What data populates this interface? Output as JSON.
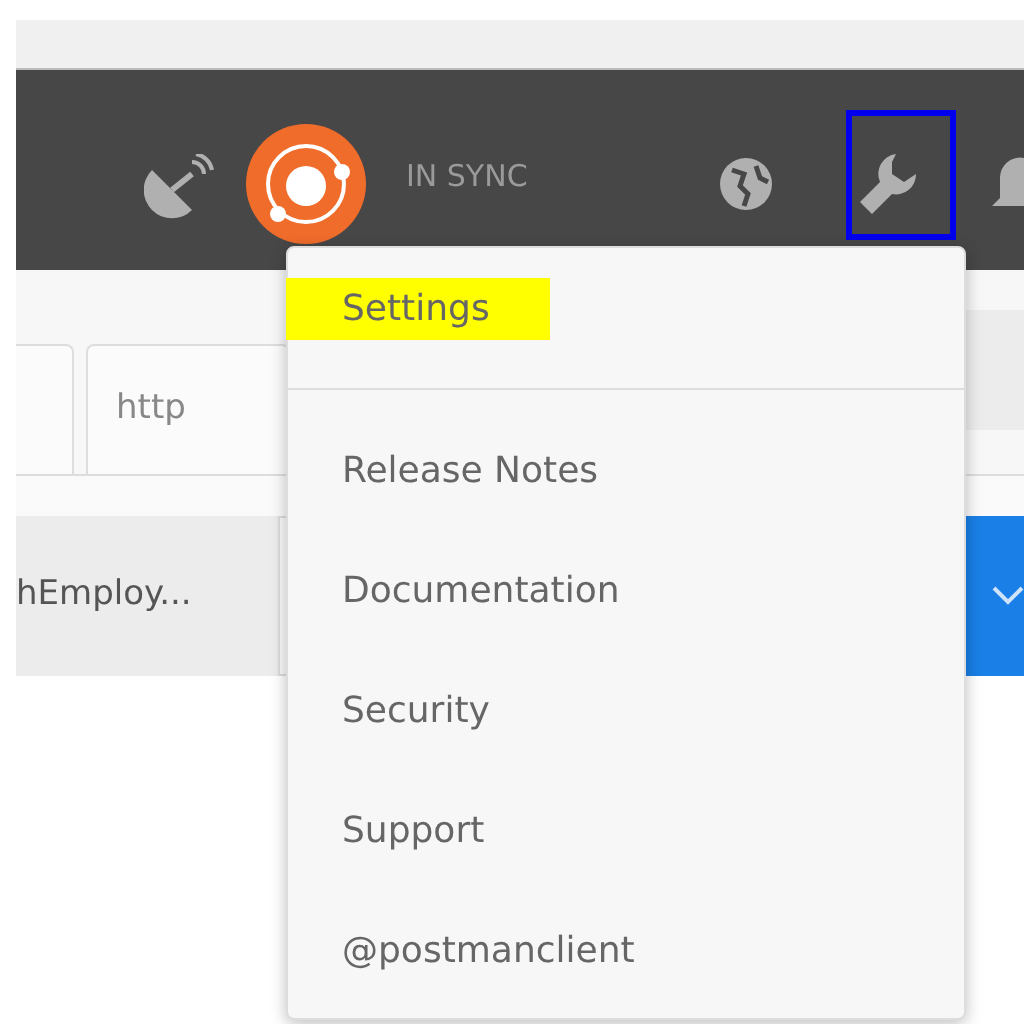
{
  "header": {
    "sync_status": "IN SYNC",
    "settings_annotated": true
  },
  "tabs": [
    {
      "kind": "partial"
    },
    {
      "kind": "tab",
      "label": "http"
    }
  ],
  "request": {
    "name": "hEmploy..."
  },
  "menu": {
    "items": [
      {
        "label": "Settings",
        "highlighted": true,
        "divider_after": true
      },
      {
        "label": "Release Notes",
        "highlighted": false,
        "divider_after": false
      },
      {
        "label": "Documentation",
        "highlighted": false,
        "divider_after": false
      },
      {
        "label": "Security",
        "highlighted": false,
        "divider_after": false
      },
      {
        "label": "Support",
        "highlighted": false,
        "divider_after": false
      },
      {
        "label": "@postmanclient",
        "highlighted": false,
        "divider_after": false
      }
    ]
  }
}
